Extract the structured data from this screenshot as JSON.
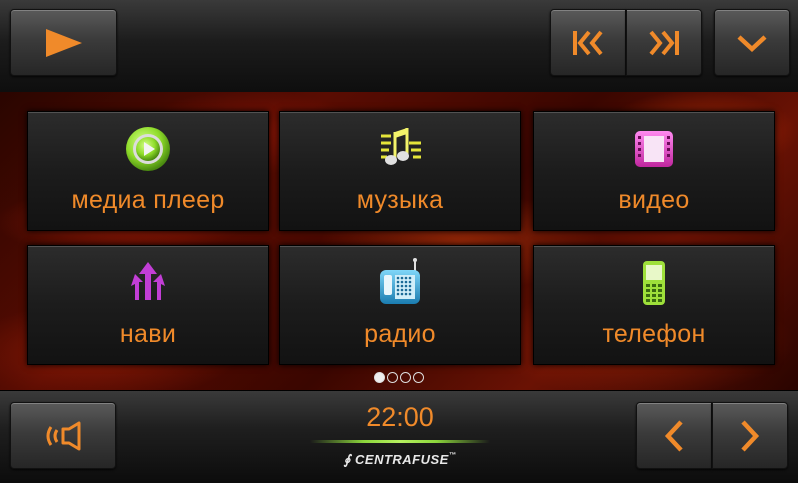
{
  "header": {
    "play_icon": "play-icon",
    "prev_icon": "skip-back-icon",
    "next_icon": "skip-forward-icon",
    "down_icon": "chevron-down-icon"
  },
  "tiles": [
    {
      "label": "медиа плеер",
      "icon": "media-player-icon"
    },
    {
      "label": "музыка",
      "icon": "music-icon"
    },
    {
      "label": "видео",
      "icon": "video-icon"
    },
    {
      "label": "нави",
      "icon": "navigation-icon"
    },
    {
      "label": "радио",
      "icon": "radio-icon"
    },
    {
      "label": "телефон",
      "icon": "phone-icon"
    }
  ],
  "pager": {
    "pages": 4,
    "active": 0
  },
  "footer": {
    "time": "22:00",
    "brand": "CENTRAFUSE",
    "trademark": "™",
    "speaker_icon": "speaker-icon",
    "left_icon": "chevron-left-icon",
    "right_icon": "chevron-right-icon"
  },
  "colors": {
    "accent": "#f08a2a",
    "media_icon": "#8fdc2a",
    "music_icon": "#e4e43a",
    "video_icon": "#e045c8",
    "navi_icon": "#c23ed6",
    "radio_icon": "#2aaee0",
    "phone_icon": "#9ee03a"
  }
}
